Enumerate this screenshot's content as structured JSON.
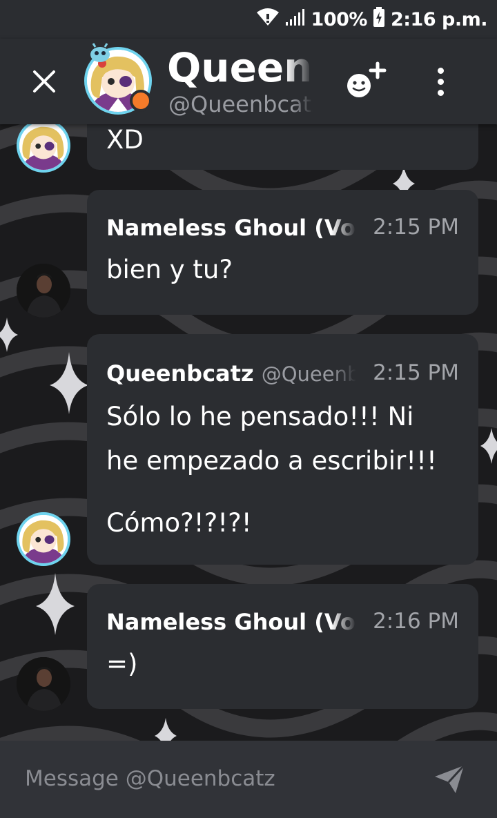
{
  "status_bar": {
    "battery_percent": "100%",
    "time": "2:16 p.m."
  },
  "header": {
    "name": "Queenbcatz",
    "handle": "@Queenbcatz",
    "presence_color": "#f47b2a"
  },
  "messages": [
    {
      "author": "",
      "handle": "",
      "time": "",
      "lines": [
        "XD"
      ]
    },
    {
      "author": "Nameless Ghoul (Vo",
      "handle": "",
      "time": "2:15 PM",
      "lines": [
        "bien y tu?"
      ]
    },
    {
      "author": "Queenbcatz",
      "handle": "@Queenbcatz",
      "time": "2:15 PM",
      "lines": [
        "Sólo lo he pensado!!! Ni",
        "he empezado a escribir!!!",
        "Cómo?!?!?!"
      ]
    },
    {
      "author": "Nameless Ghoul (Vo",
      "handle": "",
      "time": "2:16 PM",
      "lines": [
        "=)"
      ]
    }
  ],
  "composer": {
    "placeholder": "Message @Queenbcatz"
  },
  "icons": {
    "close": "close-icon",
    "add_friend": "add-friend-icon",
    "more": "more-icon",
    "send": "send-icon",
    "wifi": "wifi-icon",
    "signal": "signal-icon",
    "battery": "battery-icon"
  },
  "colors": {
    "accent_avatar_ring": "#6fd3ee",
    "bubble": "#2b2d31",
    "background": "#1b1b1d"
  }
}
